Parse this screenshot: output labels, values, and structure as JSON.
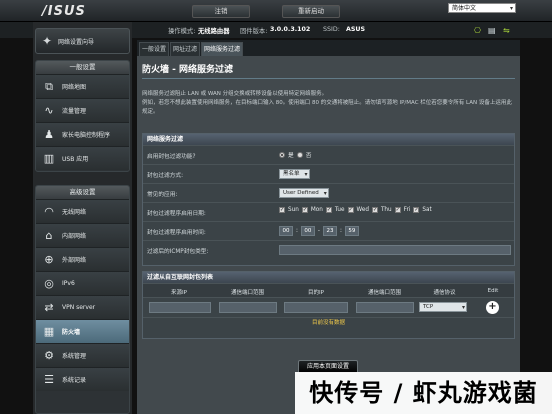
{
  "header": {
    "logo": "/ISUS",
    "logout": "注销",
    "reboot": "重新启动",
    "language": "简体中文"
  },
  "status": {
    "mode_label": "操作模式:",
    "mode_value": "无线路由器",
    "fw_label": "固件版本:",
    "fw_value": "3.0.0.3.102",
    "ssid_label": "SSID:",
    "ssid_value": "ASUS"
  },
  "sidebar": {
    "wizard": "网络设置向导",
    "general_title": "一般设置",
    "general_items": [
      {
        "label": "网络地图",
        "icon": "network-map-icon"
      },
      {
        "label": "流量管理",
        "icon": "traffic-icon"
      },
      {
        "label": "家长电脑控制程序",
        "icon": "parental-icon"
      },
      {
        "label": "USB 应用",
        "icon": "usb-icon"
      }
    ],
    "advanced_title": "高级设置",
    "advanced_items": [
      {
        "label": "无线网络",
        "icon": "wifi-icon"
      },
      {
        "label": "内部网络",
        "icon": "home-icon"
      },
      {
        "label": "外部网络",
        "icon": "globe-icon"
      },
      {
        "label": "IPv6",
        "icon": "ipv6-icon"
      },
      {
        "label": "VPN server",
        "icon": "vpn-icon"
      },
      {
        "label": "防火墙",
        "icon": "firewall-icon",
        "active": true
      },
      {
        "label": "系统管理",
        "icon": "admin-icon"
      },
      {
        "label": "系统记录",
        "icon": "log-icon"
      }
    ]
  },
  "tabs": [
    "一般设置",
    "网址过滤",
    "网络服务过滤"
  ],
  "page": {
    "title": "防火墙 - 网络服务过滤",
    "desc1": "网络服务过滤阻止 LAN 或 WAN 分组交换或转移设备以使用特定网络服务。",
    "desc2": "例如，若您不想此装置使用网络服务，在目标端口输入 80。使用端口 80 的交通将被阻止。请勿填写源地 IP/MAC 栏位若您要令所有 LAN 设备上运用此规定。"
  },
  "filter_table": {
    "title": "网络服务过滤",
    "rows": {
      "enable": "启用封包过滤功能?",
      "yes": "是",
      "no": "否",
      "method": "封包过滤方式:",
      "method_value": "黑名单",
      "common": "常见的应用:",
      "common_value": "User Defined",
      "days": "封包过滤程序启用日期:",
      "day_names": [
        "Sun",
        "Mon",
        "Tue",
        "Wed",
        "Thu",
        "Fri",
        "Sat"
      ],
      "time": "封包过滤程序启用时间:",
      "time_values": [
        "00",
        "00",
        "23",
        "59"
      ],
      "icmp": "过滤后的ICMP封包类型:"
    }
  },
  "rules_table": {
    "title": "过滤从自互联网封包列表",
    "columns": [
      "来源IP",
      "通信端口范围",
      "目的IP",
      "通信端口范围",
      "通信协议",
      "Edit"
    ],
    "protocol": "TCP",
    "no_data": "目前没有数据"
  },
  "apply_label": "应用本页面设置",
  "watermark": "快传号 / 虾丸游戏菌"
}
